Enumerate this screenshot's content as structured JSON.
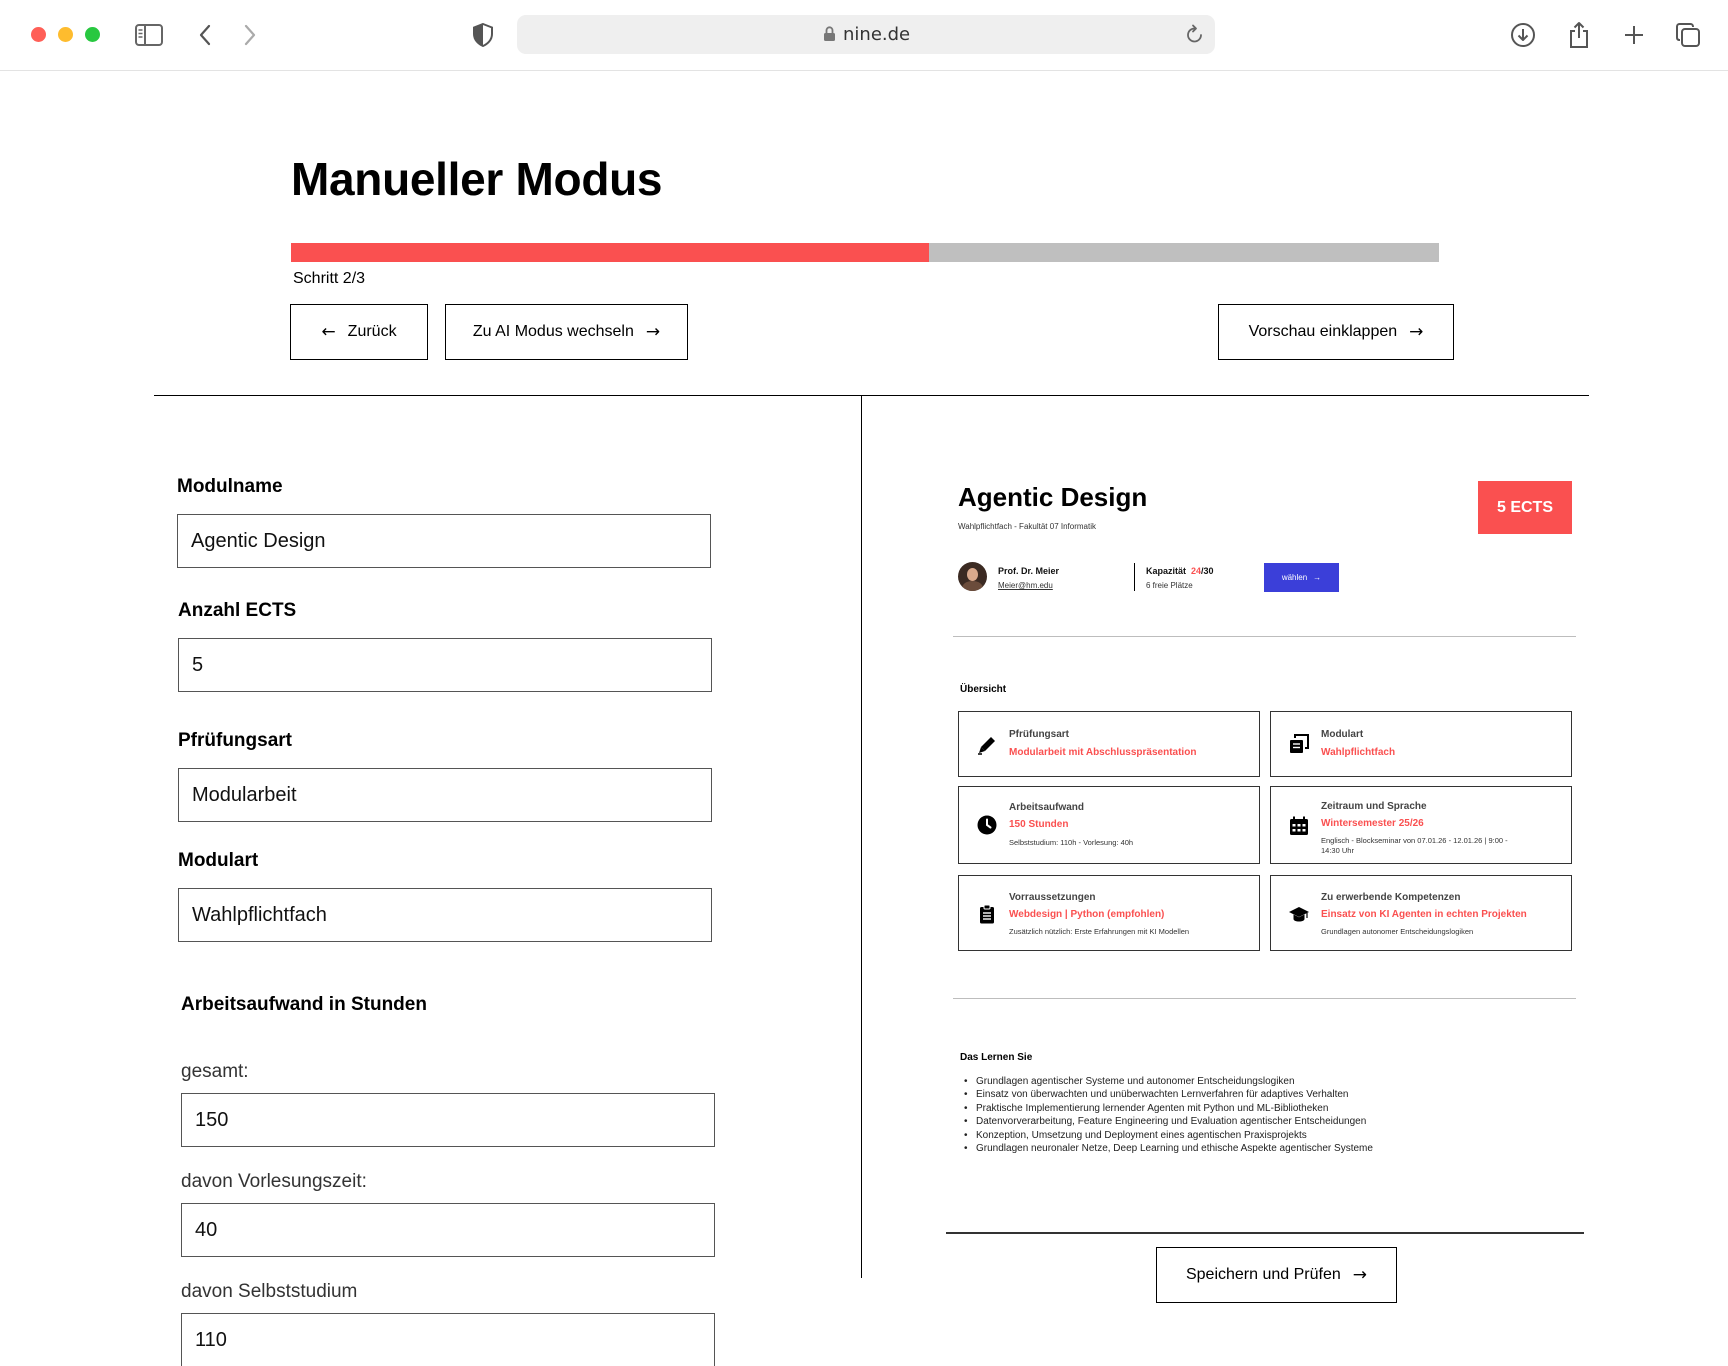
{
  "browser": {
    "url": "nine.de"
  },
  "header": {
    "title": "Manueller Modus",
    "progress": 0.556,
    "step": "Schritt 2/3",
    "back_label": "Zurück",
    "ai_label": "Zu AI Modus wechseln",
    "preview_label": "Vorschau einklappen",
    "arrow_left": "←",
    "arrow_right": "→"
  },
  "form": {
    "modulname_label": "Modulname",
    "modulname_value": "Agentic Design",
    "ects_label": "Anzahl ECTS",
    "ects_value": "5",
    "pruefungsart_label": "Pfrüfungsart",
    "pruefungsart_value": "Modularbeit",
    "modulart_label": "Modulart",
    "modulart_value": "Wahlpflichtfach",
    "workload_heading": "Arbeitsaufwand in Stunden",
    "total_label": "gesamt:",
    "total_value": "150",
    "lecture_label": "davon Vorlesungszeit:",
    "lecture_value": "40",
    "self_label": "davon Selbststudium",
    "self_value": "110"
  },
  "preview": {
    "title": "Agentic Design",
    "subtitle": "Wahlpflichtfach - Fakultät 07 Informatik",
    "ects_badge": "5 ECTS",
    "professor": "Prof. Dr. Meier",
    "email": "Meier@hm.edu",
    "capacity_label": "Kapazität",
    "capacity_taken": "24",
    "capacity_total": "/30",
    "free_places": "6 freie Plätze",
    "choose_label": "wählen",
    "overview_title": "Übersicht",
    "boxes": [
      {
        "title": "Pfrüfungsart",
        "value": "Modularbeit mit Abschlusspräsentation",
        "note": "",
        "icon": "pen-icon"
      },
      {
        "title": "Modulart",
        "value": "Wahlpflichtfach",
        "note": "",
        "icon": "copy-icon"
      },
      {
        "title": "Arbeitsaufwand",
        "value": "150 Stunden",
        "note": "Selbststudium: 110h - Vorlesung: 40h",
        "icon": "clock-icon"
      },
      {
        "title": "Zeitraum und Sprache",
        "value": "Wintersemester 25/26",
        "note": "Englisch - Blockseminar von 07.01.26 - 12.01.26 | 9:00 - 14:30 Uhr",
        "icon": "calendar-icon"
      },
      {
        "title": "Vorraussetzungen",
        "value": "Webdesign | Python (empfohlen)",
        "note": "Zusätzlich nützlich: Erste Erfahrungen mit KI Modellen",
        "icon": "clipboard-icon"
      },
      {
        "title": "Zu erwerbende Kompetenzen",
        "value": "Einsatz von KI Agenten in echten Projekten",
        "note": "Grundlagen autonomer Entscheidungslogiken",
        "icon": "graduation-cap-icon"
      }
    ],
    "learn_title": "Das Lernen Sie",
    "learn_items": [
      "Grundlagen agentischer Systeme und autonomer Entscheidungslogiken",
      "Einsatz von überwachten und unüberwachten Lernverfahren für adaptives Verhalten",
      "Praktische Implementierung lernender Agenten mit Python und ML-Bibliotheken",
      "Datenvorverarbeitung, Feature Engineering und Evaluation agentischer Entscheidungen",
      "Konzeption, Umsetzung und Deployment eines agentischen Praxisprojekts",
      "Grundlagen neuronaler Netze, Deep Learning und ethische Aspekte agentischer Systeme"
    ],
    "save_label": "Speichern und Prüfen"
  },
  "colors": {
    "accent_red": "#fa5050",
    "button_blue": "#3b3fd9",
    "progress_track": "#bfbfbf"
  }
}
